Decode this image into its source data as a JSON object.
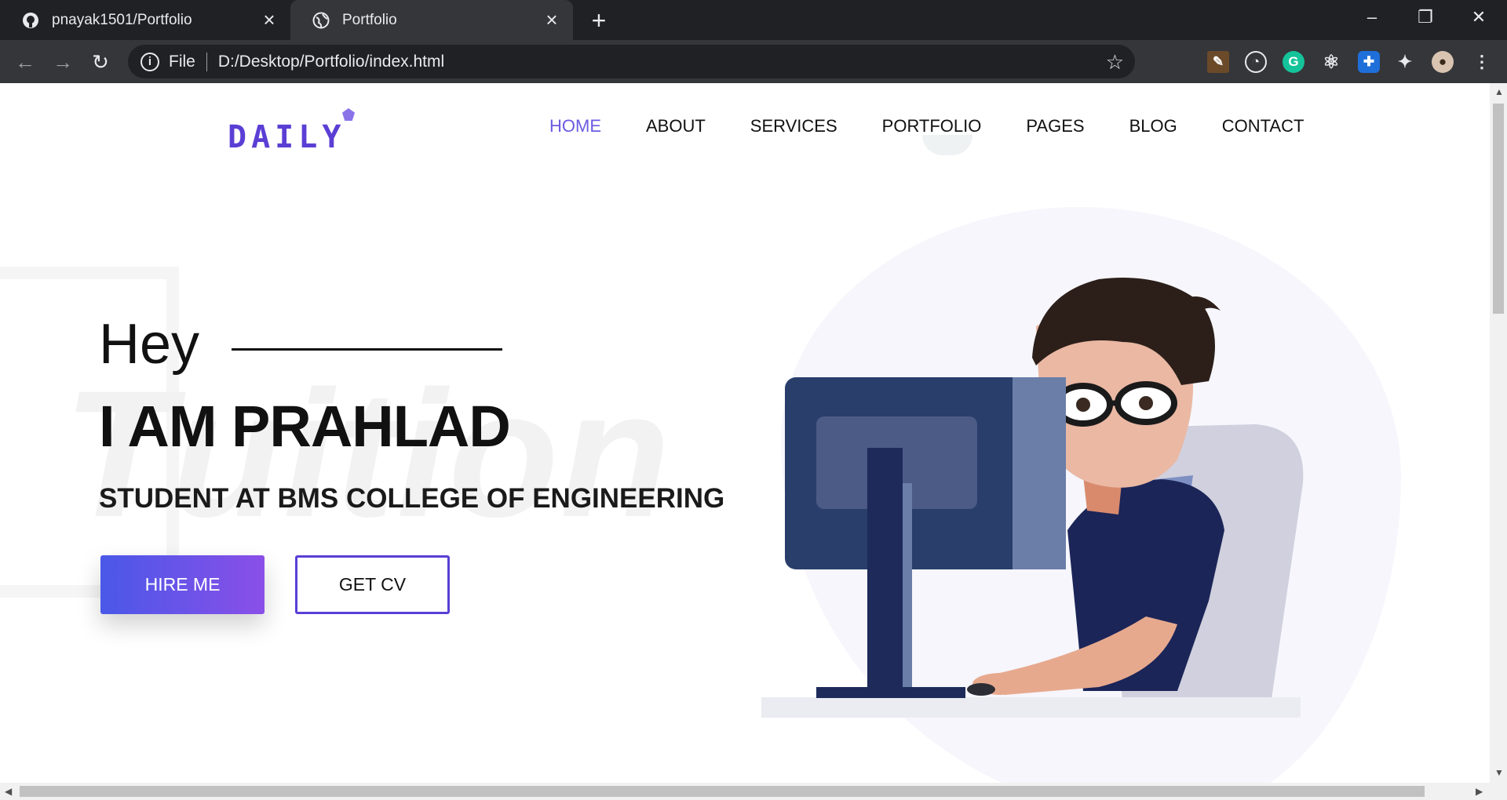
{
  "browser": {
    "tabs": [
      {
        "title": "pnayak1501/Portfolio",
        "icon": "github-icon"
      },
      {
        "title": "Portfolio",
        "icon": "globe-icon"
      }
    ],
    "address": {
      "scheme_label": "File",
      "url": "D:/Desktop/Portfolio/index.html"
    }
  },
  "site": {
    "logo": "DAILY",
    "nav": [
      "HOME",
      "ABOUT",
      "SERVICES",
      "PORTFOLIO",
      "PAGES",
      "BLOG",
      "CONTACT"
    ],
    "active_nav": "HOME",
    "hero": {
      "greeting": "Hey",
      "name": "I AM PRAHLAD",
      "subtitle": "STUDENT AT BMS COLLEGE OF ENGINEERING",
      "primary_button": "HIRE ME",
      "secondary_button": "GET CV",
      "background_word": "Tuition"
    },
    "colors": {
      "accent": "#6a5be0",
      "button_start": "#4a58e8",
      "button_end": "#8a4fe8"
    }
  }
}
